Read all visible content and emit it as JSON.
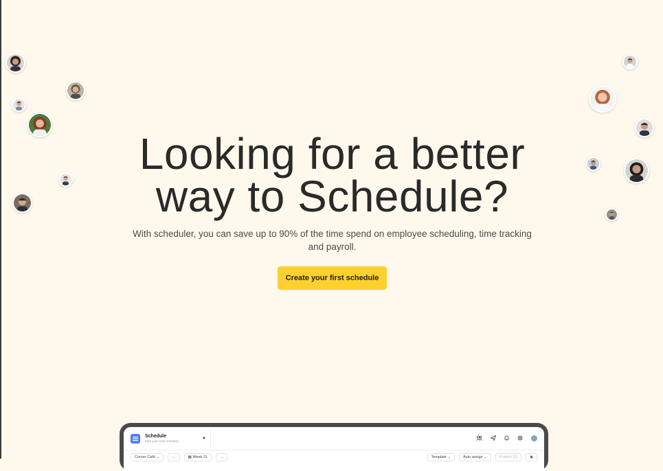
{
  "hero": {
    "headline_line1": "Looking for a better",
    "headline_line2": "way to Schedule?",
    "subtext": "With scheduler, you can save up to 90% of the time spend on employee scheduling, time tracking and payroll.",
    "cta_label": "Create your first schedule"
  },
  "colors": {
    "background": "#fff8ec",
    "cta": "#fcd02f",
    "headline": "#2a2a2a",
    "app_accent": "#4f7cf6"
  },
  "app_preview": {
    "title": "Schedule",
    "subtitle": "Plan your work schedule",
    "toolbar": {
      "location": "Corner Café",
      "week": "Week 31",
      "template": "Template",
      "auto_assign": "Auto assign",
      "publish": "Publish (0)"
    },
    "header_icons": [
      "users-icon",
      "send-icon",
      "bell-icon",
      "settings-icon",
      "avatar"
    ]
  },
  "avatars": [
    "avatar-woman-dark-hair",
    "avatar-woman-glasses",
    "avatar-man-small",
    "avatar-woman-red-hair",
    "avatar-man-suit",
    "avatar-man-beard",
    "avatar-man-top-right",
    "avatar-woman-glasses-red",
    "avatar-man-smiling",
    "avatar-man-blue",
    "avatar-man-dark",
    "avatar-man-small-right"
  ]
}
